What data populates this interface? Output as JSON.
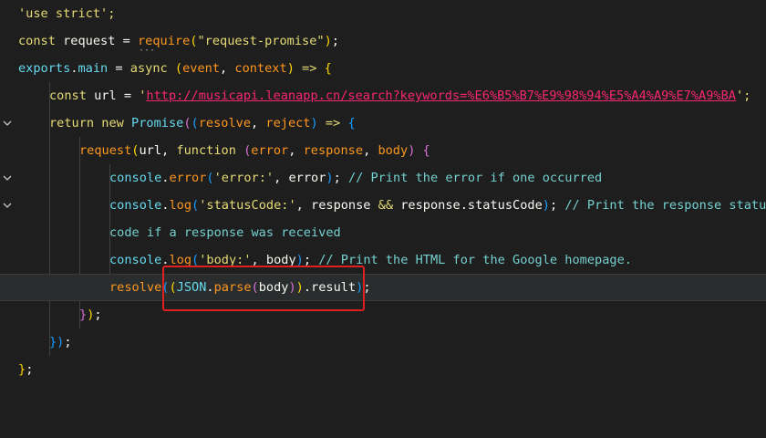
{
  "editor": {
    "lines": [
      {
        "tokens": [
          {
            "t": "'use strict';",
            "c": "t-yellow"
          }
        ]
      },
      {
        "tokens": [
          {
            "t": "const ",
            "c": "t-yellow"
          },
          {
            "t": "request",
            "c": "t-white"
          },
          {
            "t": " = ",
            "c": "t-white"
          },
          {
            "t": "require",
            "c": "t-orange"
          },
          {
            "t": "(",
            "c": "t-paren-y"
          },
          {
            "t": "\"request-promise\"",
            "c": "t-yellow"
          },
          {
            "t": ")",
            "c": "t-paren-y"
          },
          {
            "t": ";",
            "c": "t-white"
          }
        ]
      },
      {
        "tokens": [
          {
            "t": "exports",
            "c": "t-blue"
          },
          {
            "t": ".",
            "c": "t-white"
          },
          {
            "t": "main",
            "c": "t-blue"
          },
          {
            "t": " = ",
            "c": "t-white"
          },
          {
            "t": "async",
            "c": "t-yellow"
          },
          {
            "t": " (",
            "c": "t-paren-y"
          },
          {
            "t": "event",
            "c": "t-param"
          },
          {
            "t": ", ",
            "c": "t-white"
          },
          {
            "t": "context",
            "c": "t-param"
          },
          {
            "t": ")",
            "c": "t-paren-y"
          },
          {
            "t": " => ",
            "c": "t-yellow"
          },
          {
            "t": "{",
            "c": "t-paren-y"
          }
        ]
      },
      {
        "tokens": [
          {
            "t": "const ",
            "c": "t-yellow"
          },
          {
            "t": "url",
            "c": "t-white"
          },
          {
            "t": " = ",
            "c": "t-white"
          },
          {
            "t": "'",
            "c": "t-yellow"
          },
          {
            "t": "http://musicapi.leanapp.cn/search?keywords=%E6%B5%B7%E9%98%94%E5%A4%A9%E7%A9%BA",
            "c": "t-red",
            "u": true
          },
          {
            "t": "';",
            "c": "t-yellow"
          }
        ]
      },
      {
        "tokens": [
          {
            "t": "return ",
            "c": "t-yellow"
          },
          {
            "t": "new ",
            "c": "t-yellow"
          },
          {
            "t": "Promise",
            "c": "t-blue"
          },
          {
            "t": "(",
            "c": "t-paren-p"
          },
          {
            "t": "(",
            "c": "t-paren-b"
          },
          {
            "t": "resolve",
            "c": "t-param"
          },
          {
            "t": ", ",
            "c": "t-white"
          },
          {
            "t": "reject",
            "c": "t-param"
          },
          {
            "t": ")",
            "c": "t-paren-b"
          },
          {
            "t": " => ",
            "c": "t-yellow"
          },
          {
            "t": "{",
            "c": "t-paren-b"
          }
        ]
      },
      {
        "tokens": [
          {
            "t": "request",
            "c": "t-orange"
          },
          {
            "t": "(",
            "c": "t-paren-y"
          },
          {
            "t": "url",
            "c": "t-white"
          },
          {
            "t": ", ",
            "c": "t-white"
          },
          {
            "t": "function",
            "c": "t-yellow"
          },
          {
            "t": " (",
            "c": "t-paren-p"
          },
          {
            "t": "error",
            "c": "t-param"
          },
          {
            "t": ", ",
            "c": "t-white"
          },
          {
            "t": "response",
            "c": "t-param"
          },
          {
            "t": ", ",
            "c": "t-white"
          },
          {
            "t": "body",
            "c": "t-param"
          },
          {
            "t": ")",
            "c": "t-paren-p"
          },
          {
            "t": " {",
            "c": "t-paren-p"
          }
        ]
      },
      {
        "tokens": [
          {
            "t": "console",
            "c": "t-blue"
          },
          {
            "t": ".",
            "c": "t-white"
          },
          {
            "t": "error",
            "c": "t-orange"
          },
          {
            "t": "(",
            "c": "t-paren-b"
          },
          {
            "t": "'error:'",
            "c": "t-yellow"
          },
          {
            "t": ", ",
            "c": "t-white"
          },
          {
            "t": "error",
            "c": "t-white"
          },
          {
            "t": ")",
            "c": "t-paren-b"
          },
          {
            "t": "; ",
            "c": "t-white"
          },
          {
            "t": "// Print the error if one occurred",
            "c": "t-cmt"
          }
        ]
      },
      {
        "tokens": [
          {
            "t": "console",
            "c": "t-blue"
          },
          {
            "t": ".",
            "c": "t-white"
          },
          {
            "t": "log",
            "c": "t-orange"
          },
          {
            "t": "(",
            "c": "t-paren-b"
          },
          {
            "t": "'statusCode:'",
            "c": "t-yellow"
          },
          {
            "t": ", ",
            "c": "t-white"
          },
          {
            "t": "response",
            "c": "t-white"
          },
          {
            "t": " && ",
            "c": "t-yellow"
          },
          {
            "t": "response",
            "c": "t-white"
          },
          {
            "t": ".",
            "c": "t-white"
          },
          {
            "t": "statusCode",
            "c": "t-white"
          },
          {
            "t": ")",
            "c": "t-paren-b"
          },
          {
            "t": "; ",
            "c": "t-white"
          },
          {
            "t": "// Print the response status",
            "c": "t-cmt"
          }
        ]
      },
      {
        "tokens": [
          {
            "t": "code if a response was received",
            "c": "t-cmt"
          }
        ]
      },
      {
        "tokens": [
          {
            "t": "console",
            "c": "t-blue"
          },
          {
            "t": ".",
            "c": "t-white"
          },
          {
            "t": "log",
            "c": "t-orange"
          },
          {
            "t": "(",
            "c": "t-paren-b"
          },
          {
            "t": "'body:'",
            "c": "t-yellow"
          },
          {
            "t": ", ",
            "c": "t-white"
          },
          {
            "t": "body",
            "c": "t-white"
          },
          {
            "t": ")",
            "c": "t-paren-b"
          },
          {
            "t": "; ",
            "c": "t-white"
          },
          {
            "t": "// Print the HTML for the Google homepage.",
            "c": "t-cmt"
          }
        ]
      },
      {
        "tokens": [
          {
            "t": "resolve",
            "c": "t-orange"
          },
          {
            "t": "(",
            "c": "t-paren-b"
          },
          {
            "t": "(",
            "c": "t-paren-y"
          },
          {
            "t": "JSON",
            "c": "t-blue"
          },
          {
            "t": ".",
            "c": "t-white"
          },
          {
            "t": "parse",
            "c": "t-orange"
          },
          {
            "t": "(",
            "c": "t-paren-p"
          },
          {
            "t": "body",
            "c": "t-white"
          },
          {
            "t": ")",
            "c": "t-paren-p"
          },
          {
            "t": ")",
            "c": "t-paren-y"
          },
          {
            "t": ".",
            "c": "t-white"
          },
          {
            "t": "result",
            "c": "t-white"
          },
          {
            "t": ")",
            "c": "t-paren-b"
          },
          {
            "t": ";",
            "c": "t-white"
          }
        ]
      },
      {
        "tokens": [
          {
            "t": "}",
            "c": "t-paren-p"
          },
          {
            "t": ")",
            "c": "t-paren-y"
          },
          {
            "t": ";",
            "c": "t-white"
          }
        ]
      },
      {
        "tokens": [
          {
            "t": "})",
            "c": "t-paren-b"
          },
          {
            "t": ";",
            "c": "t-white"
          }
        ]
      },
      {
        "tokens": [
          {
            "t": "}",
            "c": "t-paren-y"
          },
          {
            "t": ";",
            "c": "t-white"
          }
        ]
      }
    ]
  }
}
